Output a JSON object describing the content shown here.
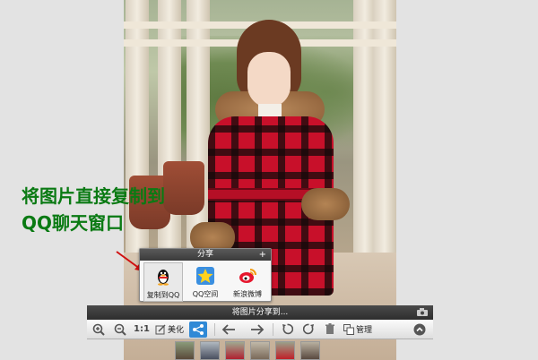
{
  "instruction": {
    "line1": "将图片直接复制到",
    "line2": "QQ聊天窗口",
    "color": "#0a7a13"
  },
  "share_popup": {
    "title": "分享",
    "plus": "+",
    "items": [
      {
        "label": "复制到QQ",
        "icon": "qq-penguin-icon"
      },
      {
        "label": "QQ空间",
        "icon": "qzone-star-icon"
      },
      {
        "label": "新浪微博",
        "icon": "weibo-icon"
      }
    ]
  },
  "status_bar": {
    "text": "将图片分享到..."
  },
  "toolbar": {
    "actual_size_label": "1:1",
    "beautify_label": "美化",
    "manage_label": "管理"
  },
  "colors": {
    "accent": "#2f89d6",
    "arrow": "#d01010"
  }
}
